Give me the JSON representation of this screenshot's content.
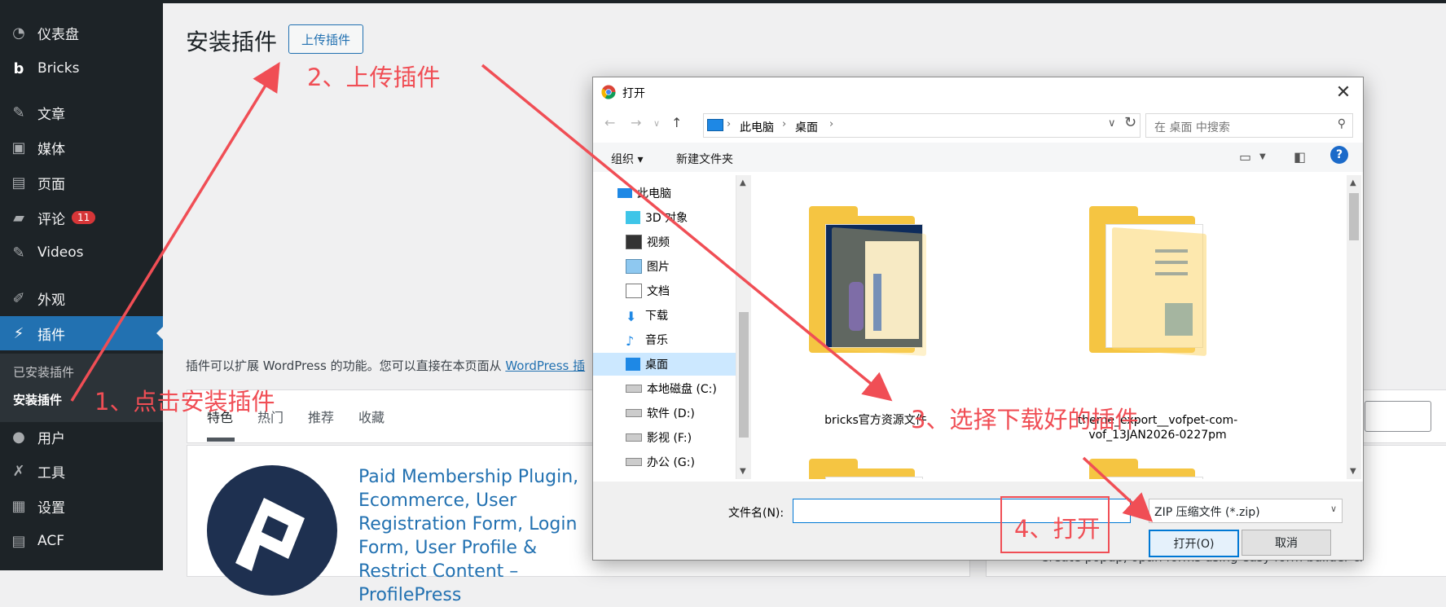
{
  "sidebar": {
    "items": [
      {
        "label": "仪表盘",
        "icon": "dashboard-icon"
      },
      {
        "label": "Bricks",
        "icon": "bricks-icon"
      },
      {
        "label": "文章",
        "icon": "pin-icon"
      },
      {
        "label": "媒体",
        "icon": "media-icon"
      },
      {
        "label": "页面",
        "icon": "page-icon"
      },
      {
        "label": "评论",
        "icon": "comment-icon",
        "badge": "11"
      },
      {
        "label": "Videos",
        "icon": "pin-icon"
      },
      {
        "label": "外观",
        "icon": "brush-icon"
      },
      {
        "label": "插件",
        "icon": "plugin-icon"
      },
      {
        "label": "用户",
        "icon": "user-icon"
      },
      {
        "label": "工具",
        "icon": "wrench-icon"
      },
      {
        "label": "设置",
        "icon": "settings-icon"
      },
      {
        "label": "ACF",
        "icon": "acf-icon"
      }
    ],
    "submenu": [
      "已安装插件",
      "安装插件"
    ]
  },
  "main": {
    "page_title": "安装插件",
    "upload_button": "上传插件",
    "intro_text": "插件可以扩展 WordPress 的功能。您可以直接在本页面从 ",
    "intro_link": "WordPress 插",
    "tabs": [
      "特色",
      "热门",
      "推荐",
      "收藏"
    ],
    "plugin_name": "Paid Membership Plugin, Ecommerce, User Registration Form, Login Form, User Profile & Restrict Content – ProfilePress",
    "right_card_text": "Create popup, optin forms using easy form builder &"
  },
  "dialog": {
    "title": "打开",
    "close": "✕",
    "breadcrumbs": [
      "此电脑",
      "桌面"
    ],
    "search_placeholder": "在 桌面 中搜索",
    "organize": "组织 ▾",
    "new_folder": "新建文件夹",
    "help": "?",
    "tree": [
      {
        "label": "此电脑",
        "icon": "computer-icon",
        "level": 1
      },
      {
        "label": "3D 对象",
        "icon": "cube-icon",
        "level": 2
      },
      {
        "label": "视频",
        "icon": "video-icon",
        "level": 2
      },
      {
        "label": "图片",
        "icon": "picture-icon",
        "level": 2
      },
      {
        "label": "文档",
        "icon": "document-icon",
        "level": 2
      },
      {
        "label": "下载",
        "icon": "download-icon",
        "level": 2
      },
      {
        "label": "音乐",
        "icon": "music-icon",
        "level": 2
      },
      {
        "label": "桌面",
        "icon": "desktop-icon",
        "level": 2,
        "selected": true
      },
      {
        "label": "本地磁盘 (C:)",
        "icon": "drive-icon",
        "level": 2
      },
      {
        "label": "软件 (D:)",
        "icon": "drive-icon",
        "level": 2
      },
      {
        "label": "影视 (F:)",
        "icon": "drive-icon",
        "level": 2
      },
      {
        "label": "办公 (G:)",
        "icon": "drive-icon",
        "level": 2
      }
    ],
    "files": [
      {
        "name": "bricks官方资源文件"
      },
      {
        "name": "theme_export__vofpet-com-vof_13JAN2026-0227pm"
      }
    ],
    "filename_label": "文件名(N):",
    "filename_value": "",
    "filetype": "ZIP 压缩文件 (*.zip)",
    "open_button": "打开(O)",
    "cancel_button": "取消"
  },
  "annotations": {
    "step1": "1、点击安装插件",
    "step2": "2、上传插件",
    "step3": "3、选择下载好的插件",
    "step4": "4、打开",
    "color": "#f04e55"
  },
  "colors": {
    "sidebar_bg": "#1d2327",
    "active": "#2271b1",
    "badge": "#d63638",
    "link": "#2271b1"
  }
}
